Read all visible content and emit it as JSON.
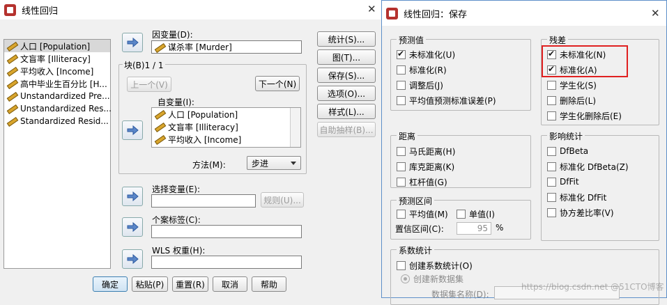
{
  "main_dialog": {
    "title": "线性回归",
    "variables": [
      {
        "label": "人口 [Population]",
        "selected": true
      },
      {
        "label": "文盲率 [Illiteracy]",
        "selected": false
      },
      {
        "label": "平均收入 [Income]",
        "selected": false
      },
      {
        "label": "高中毕业生百分比 [H...",
        "selected": false
      },
      {
        "label": "Unstandardized Pre...",
        "selected": false
      },
      {
        "label": "Unstandardized Res...",
        "selected": false
      },
      {
        "label": "Standardized Resid...",
        "selected": false
      }
    ],
    "dependent_label": "因变量(D):",
    "dependent_value": "谋杀率 [Murder]",
    "block_label": "块(B)1 / 1",
    "prev_button": "上一个(V)",
    "next_button": "下一个(N)",
    "independent_label": "自变量(I):",
    "independents": [
      "人口 [Population]",
      "文盲率 [Illiteracy]",
      "平均收入 [Income]"
    ],
    "method_label": "方法(M):",
    "method_value": "步进",
    "selection_label": "选择变量(E):",
    "rule_button": "规则(U)...",
    "case_label": "个案标签(C):",
    "wls_label": "WLS 权重(H):",
    "side_buttons": [
      "统计(S)...",
      "图(T)...",
      "保存(S)...",
      "选项(O)...",
      "样式(L)...",
      "自助抽样(B)..."
    ],
    "bottom_buttons": [
      "确定",
      "粘贴(P)",
      "重置(R)",
      "取消",
      "帮助"
    ]
  },
  "save_dialog": {
    "title": "线性回归：保存",
    "predicted": {
      "title": "预测值",
      "items": [
        {
          "label": "未标准化(U)",
          "checked": true
        },
        {
          "label": "标准化(R)",
          "checked": false
        },
        {
          "label": "调整后(J)",
          "checked": false
        },
        {
          "label": "平均值预测标准误差(P)",
          "checked": false
        }
      ]
    },
    "residuals": {
      "title": "残差",
      "items": [
        {
          "label": "未标准化(N)",
          "checked": true
        },
        {
          "label": "标准化(A)",
          "checked": true
        },
        {
          "label": "学生化(S)",
          "checked": false
        },
        {
          "label": "删除后(L)",
          "checked": false
        },
        {
          "label": "学生化删除后(E)",
          "checked": false
        }
      ]
    },
    "distance": {
      "title": "距离",
      "items": [
        {
          "label": "马氏距离(H)",
          "checked": false
        },
        {
          "label": "库克距离(K)",
          "checked": false
        },
        {
          "label": "杠杆值(G)",
          "checked": false
        }
      ]
    },
    "influence": {
      "title": "影响统计",
      "items": [
        {
          "label": "DfBeta",
          "checked": false
        },
        {
          "label": "标准化 DfBeta(Z)",
          "checked": false
        },
        {
          "label": "DfFit",
          "checked": false
        },
        {
          "label": "标准化 DfFit",
          "checked": false
        },
        {
          "label": "协方差比率(V)",
          "checked": false
        }
      ]
    },
    "prediction_interval": {
      "title": "预测区间",
      "mean_label": "平均值(M)",
      "single_label": "单值(I)",
      "ci_label": "置信区间(C):",
      "ci_value": "95",
      "ci_unit": "%"
    },
    "coefficients": {
      "title": "系数统计",
      "create_label": "创建系数统计(O)",
      "new_dataset_label": "创建新数据集",
      "dataset_name_label": "数据集名称(D):"
    }
  },
  "watermark": "https://blog.csdn.net @51CTO博客",
  "colors": {
    "highlight_box": "#e02020",
    "accent_blue": "#3c7fb1"
  }
}
